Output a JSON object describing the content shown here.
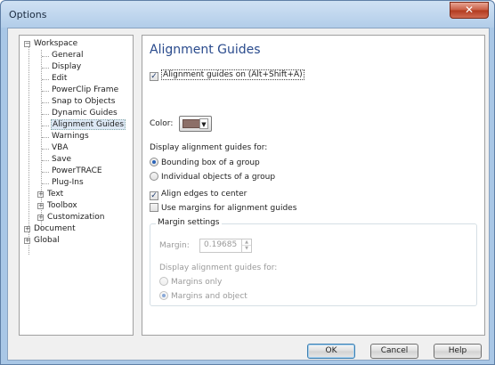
{
  "window": {
    "title": "Options",
    "close_glyph": "✕"
  },
  "tree": {
    "items": [
      {
        "label": "Workspace",
        "expander": "−"
      },
      {
        "label": "General"
      },
      {
        "label": "Display"
      },
      {
        "label": "Edit"
      },
      {
        "label": "PowerClip Frame"
      },
      {
        "label": "Snap to Objects"
      },
      {
        "label": "Dynamic Guides"
      },
      {
        "label": "Alignment Guides"
      },
      {
        "label": "Warnings"
      },
      {
        "label": "VBA"
      },
      {
        "label": "Save"
      },
      {
        "label": "PowerTRACE"
      },
      {
        "label": "Plug-Ins"
      },
      {
        "label": "Text",
        "expander": "+"
      },
      {
        "label": "Toolbox",
        "expander": "+"
      },
      {
        "label": "Customization",
        "expander": "+"
      },
      {
        "label": "Document",
        "expander": "+"
      },
      {
        "label": "Global",
        "expander": "+"
      }
    ]
  },
  "panel": {
    "title": "Alignment Guides",
    "guides_on": {
      "label": "Alignment guides on (Alt+Shift+A)",
      "checked": true,
      "check_glyph": "✓"
    },
    "color": {
      "label": "Color:",
      "value": "#8c6f68",
      "arrow_glyph": "▼"
    },
    "display_for_label": "Display alignment guides for:",
    "radio_bounding": {
      "label": "Bounding box of a group",
      "selected": true
    },
    "radio_individual": {
      "label": "Individual objects of a group",
      "selected": false
    },
    "align_edges": {
      "label": "Align edges to center",
      "checked": true,
      "check_glyph": "✓"
    },
    "use_margins": {
      "label": "Use margins for alignment guides",
      "checked": false
    },
    "margin_settings": {
      "group_label": "Margin settings",
      "margin_label": "Margin:",
      "margin_value": "0.19685",
      "spin_up_glyph": "▲",
      "spin_down_glyph": "▼",
      "display_for_label": "Display alignment guides for:",
      "radio_margins_only": {
        "label": "Margins only",
        "selected": false
      },
      "radio_margins_object": {
        "label": "Margins and object",
        "selected": true
      }
    }
  },
  "buttons": {
    "ok": "OK",
    "cancel": "Cancel",
    "help": "Help"
  }
}
